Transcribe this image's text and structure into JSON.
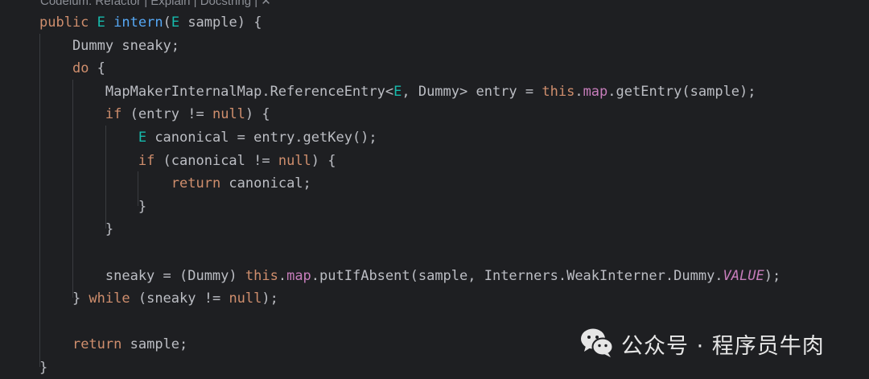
{
  "codelens": {
    "text": "Codeium: Refactor | Explain | Docstring | ✕"
  },
  "code": {
    "lines": [
      [
        {
          "t": "public ",
          "c": "kw"
        },
        {
          "t": "E",
          "c": "ty"
        },
        {
          "t": " ",
          "c": "plain"
        },
        {
          "t": "intern",
          "c": "fn"
        },
        {
          "t": "(",
          "c": "plain"
        },
        {
          "t": "E",
          "c": "ty"
        },
        {
          "t": " sample) {",
          "c": "plain"
        }
      ],
      [
        {
          "t": "    Dummy sneaky;",
          "c": "plain"
        }
      ],
      [
        {
          "t": "    ",
          "c": "plain"
        },
        {
          "t": "do",
          "c": "kw"
        },
        {
          "t": " {",
          "c": "plain"
        }
      ],
      [
        {
          "t": "        MapMakerInternalMap.ReferenceEntry<",
          "c": "plain"
        },
        {
          "t": "E",
          "c": "ty"
        },
        {
          "t": ", Dummy> entry = ",
          "c": "plain"
        },
        {
          "t": "this",
          "c": "kw"
        },
        {
          "t": ".",
          "c": "plain"
        },
        {
          "t": "map",
          "c": "fld"
        },
        {
          "t": ".getEntry(sample);",
          "c": "plain"
        }
      ],
      [
        {
          "t": "        ",
          "c": "plain"
        },
        {
          "t": "if",
          "c": "kw"
        },
        {
          "t": " (entry != ",
          "c": "plain"
        },
        {
          "t": "null",
          "c": "kw"
        },
        {
          "t": ") {",
          "c": "plain"
        }
      ],
      [
        {
          "t": "            ",
          "c": "plain"
        },
        {
          "t": "E",
          "c": "ty"
        },
        {
          "t": " canonical = entry.getKey();",
          "c": "plain"
        }
      ],
      [
        {
          "t": "            ",
          "c": "plain"
        },
        {
          "t": "if",
          "c": "kw"
        },
        {
          "t": " (canonical != ",
          "c": "plain"
        },
        {
          "t": "null",
          "c": "kw"
        },
        {
          "t": ") {",
          "c": "plain"
        }
      ],
      [
        {
          "t": "                ",
          "c": "plain"
        },
        {
          "t": "return",
          "c": "kw"
        },
        {
          "t": " canonical;",
          "c": "plain"
        }
      ],
      [
        {
          "t": "            }",
          "c": "plain"
        }
      ],
      [
        {
          "t": "        }",
          "c": "plain"
        }
      ],
      [],
      [
        {
          "t": "        sneaky = (Dummy) ",
          "c": "plain"
        },
        {
          "t": "this",
          "c": "kw"
        },
        {
          "t": ".",
          "c": "plain"
        },
        {
          "t": "map",
          "c": "fld"
        },
        {
          "t": ".putIfAbsent(sample, Interners.WeakInterner.Dummy.",
          "c": "plain"
        },
        {
          "t": "VALUE",
          "c": "cst"
        },
        {
          "t": ");",
          "c": "plain"
        }
      ],
      [
        {
          "t": "    } ",
          "c": "plain"
        },
        {
          "t": "while",
          "c": "kw"
        },
        {
          "t": " (sneaky != ",
          "c": "plain"
        },
        {
          "t": "null",
          "c": "kw"
        },
        {
          "t": ");",
          "c": "plain"
        }
      ],
      [],
      [
        {
          "t": "    ",
          "c": "plain"
        },
        {
          "t": "return",
          "c": "kw"
        },
        {
          "t": " sample;",
          "c": "plain"
        }
      ],
      [
        {
          "t": "}",
          "c": "plain"
        }
      ]
    ]
  },
  "watermark": {
    "text": "公众号 · 程序员牛肉",
    "icon": "wechat-icon"
  },
  "colors": {
    "background": "#1e1f22",
    "keyword": "#cf8e6d",
    "type_param": "#16baac",
    "method_decl": "#56a8f5",
    "field": "#c77dbb",
    "text": "#bcbec4",
    "codelens": "#8c8f96"
  }
}
